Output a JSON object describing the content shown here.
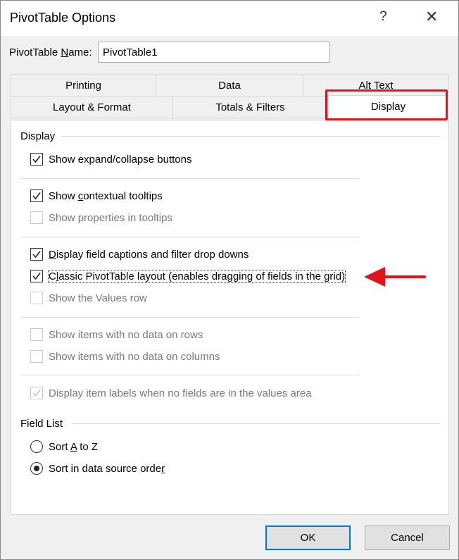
{
  "window": {
    "title": "PivotTable Options",
    "help": "?",
    "close": "✕"
  },
  "name_field": {
    "label_pre": "PivotTable ",
    "label_acc": "N",
    "label_post": "ame:",
    "value": "PivotTable1"
  },
  "tabs": {
    "row1": [
      "Printing",
      "Data",
      "Alt Text"
    ],
    "row2": [
      "Layout & Format",
      "Totals & Filters",
      "Display"
    ],
    "active": "Display"
  },
  "display_group": {
    "title": "Display",
    "options": [
      {
        "pre": "Show expand/collapse buttons",
        "acc": "",
        "post": "",
        "checked": true,
        "enabled": true
      },
      {
        "pre": "Show ",
        "acc": "c",
        "post": "ontextual tooltips",
        "checked": true,
        "enabled": true
      },
      {
        "pre": "Show properties in tooltips",
        "acc": "",
        "post": "",
        "checked": false,
        "enabled": false
      },
      {
        "pre": "",
        "acc": "D",
        "post": "isplay field captions and filter drop downs",
        "checked": true,
        "enabled": true
      },
      {
        "pre": "C",
        "acc": "l",
        "post": "assic PivotTable layout (enables dragging of fields in the grid)",
        "checked": true,
        "enabled": true
      },
      {
        "pre": "Show the Values row",
        "acc": "",
        "post": "",
        "checked": false,
        "enabled": false
      },
      {
        "pre": "Show items with no data on rows",
        "acc": "",
        "post": "",
        "checked": false,
        "enabled": false
      },
      {
        "pre": "Show items with no data on columns",
        "acc": "",
        "post": "",
        "checked": false,
        "enabled": false
      },
      {
        "pre": "Display item labels when no fields are in the values area",
        "acc": "",
        "post": "",
        "checked": true,
        "enabled": false
      }
    ]
  },
  "field_list": {
    "title": "Field List",
    "options": [
      {
        "pre": "Sort ",
        "acc": "A",
        "post": " to Z",
        "selected": false
      },
      {
        "pre": "Sort in data source orde",
        "acc": "r",
        "post": "",
        "selected": true
      }
    ]
  },
  "buttons": {
    "ok": "OK",
    "cancel": "Cancel"
  },
  "annotation_color": "#e3111a"
}
